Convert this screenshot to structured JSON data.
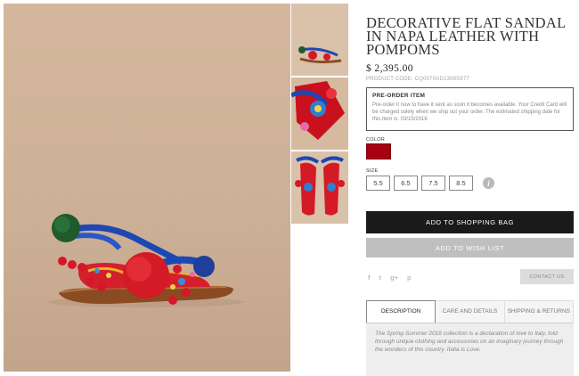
{
  "product": {
    "title": "DECORATIVE FLAT SANDAL IN NAPA LEATHER WITH POMPOMS",
    "price": "$ 2,395.00",
    "product_code": "PRODUCT CODE: CQ0070AD1308S877"
  },
  "preorder": {
    "title": "PRE-ORDER ITEM",
    "text": "Pre-order it now to have it sent as soon it becomes available. Your Credit Card will be charged solely when we ship out your order. The estimated shipping date for this item is: 03/15/2016"
  },
  "color": {
    "label": "COLOR",
    "selected_hex": "#a80013"
  },
  "size": {
    "label": "SIZE",
    "options": [
      "5.5",
      "6.5",
      "7.5",
      "8.5"
    ],
    "info_icon": "i"
  },
  "buttons": {
    "add_to_bag": "ADD TO SHOPPING BAG",
    "add_to_wishlist": "ADD TO WISH LIST",
    "contact": "CONTACT US"
  },
  "social": {
    "facebook": "f",
    "twitter": "t",
    "googleplus": "g+",
    "pinterest": "p"
  },
  "tabs": [
    {
      "label": "DESCRIPTION",
      "active": true
    },
    {
      "label": "CARE AND DETAILS",
      "active": false
    },
    {
      "label": "SHIPPING & RETURNS",
      "active": false
    }
  ],
  "description": "The Spring-Summer 2016 collection is a declaration of love to Italy, told through unique clothing and accessories on an imaginary journey through the wonders of this country. Italia is Love.",
  "colors": {
    "background": "#cdb196",
    "button_dark": "#1a1a1a",
    "button_light": "#bfbfbf",
    "swatch_red": "#a80013"
  }
}
